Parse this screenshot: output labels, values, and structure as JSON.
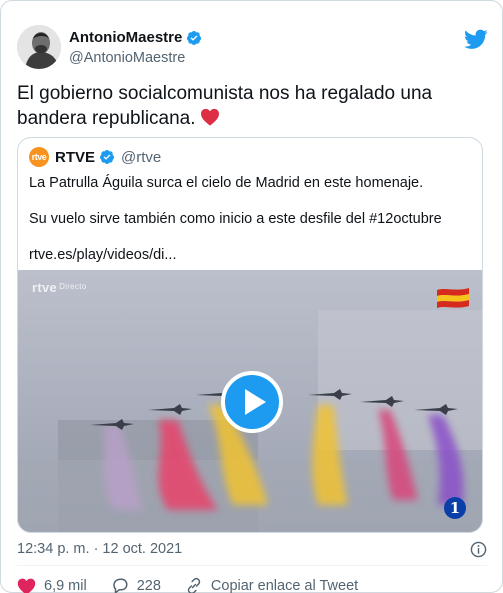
{
  "author": {
    "name": "AntonioMaestre",
    "handle": "@AntonioMaestre"
  },
  "tweet": {
    "text": "El gobierno socialcomunista nos ha regalado una bandera republicana."
  },
  "quoted": {
    "logo_text": "rtve",
    "name": "RTVE",
    "handle": "@rtve",
    "lines": [
      "La Patrulla Águila surca el cielo de Madrid en este homenaje.",
      "Su vuelo sirve también como inicio a este desfile del #12octubre",
      "rtve.es/play/videos/di..."
    ],
    "media": {
      "watermark": "rtve",
      "watermark_sub": "Directo",
      "channel_badge": "1",
      "smoke_colors": [
        "#e8436b",
        "#f1c232",
        "#e8436b",
        "#8a4fc9"
      ]
    }
  },
  "meta": {
    "timestamp": "12:34 p. m. · 12 oct. 2021"
  },
  "actions": {
    "likes": "6,9 mil",
    "replies": "228",
    "copy_link": "Copiar enlace al Tweet"
  },
  "colors": {
    "accent": "#1d9bf0",
    "text": "#0f1419",
    "secondary": "#536471",
    "heart": "#e0245e"
  }
}
